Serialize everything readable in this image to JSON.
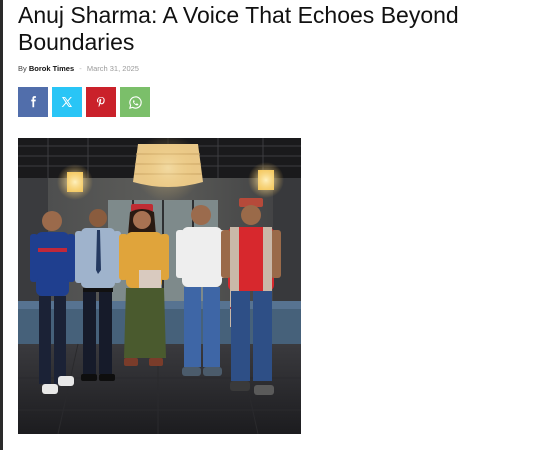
{
  "article": {
    "title": "Anuj Sharma: A Voice That Echoes Beyond Boundaries",
    "meta": {
      "by_label": "By",
      "author": "Borok Times",
      "separator": "-",
      "date": "March 31, 2025"
    }
  },
  "share": {
    "buttons": [
      {
        "name": "facebook",
        "icon": "facebook-icon",
        "color": "#516eab"
      },
      {
        "name": "twitter-x",
        "icon": "x-icon",
        "color": "#29c5f6"
      },
      {
        "name": "pinterest",
        "icon": "pinterest-icon",
        "color": "#ca212a"
      },
      {
        "name": "whatsapp",
        "icon": "whatsapp-icon",
        "color": "#7bbf6a"
      }
    ]
  },
  "photo": {
    "subject": "group-of-five-men-in-restaurant-with-hanging-lamps"
  },
  "colors": {
    "text": "#111111",
    "muted": "#9a9a9a"
  }
}
